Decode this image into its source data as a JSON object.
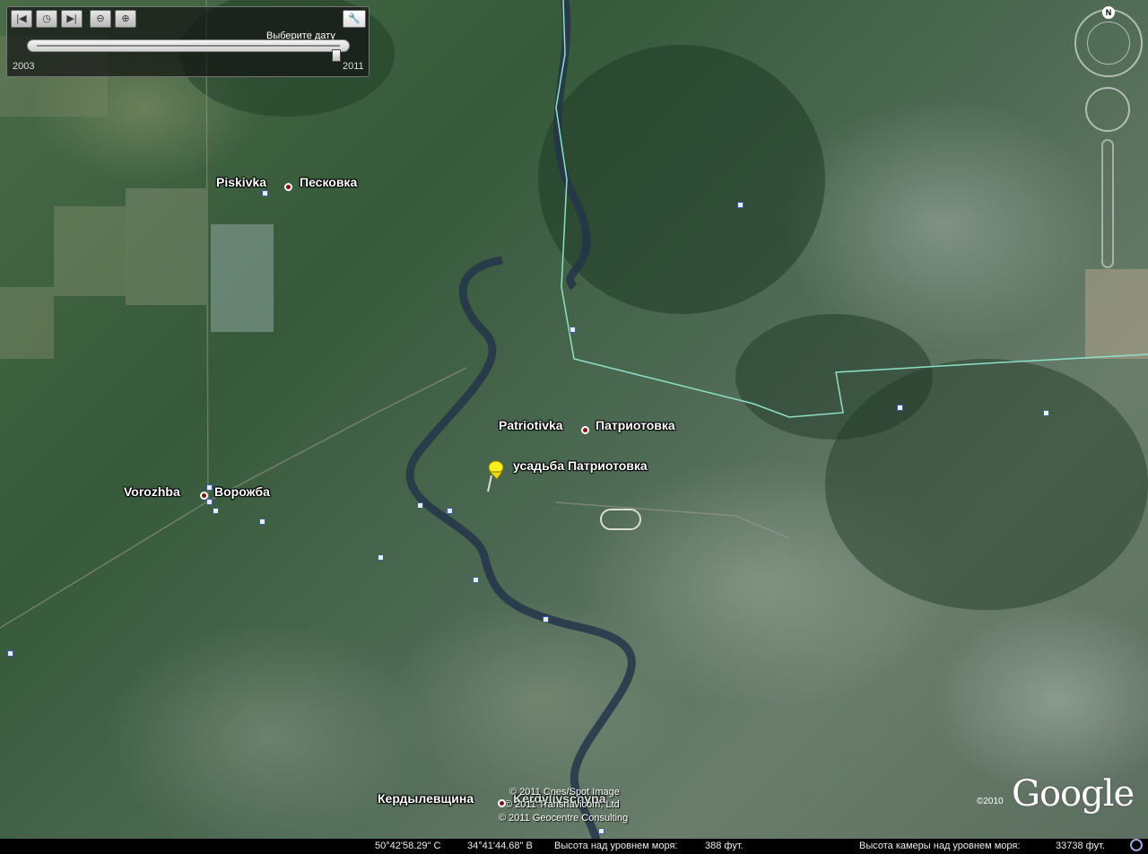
{
  "timeslider": {
    "title": "Выберите дату",
    "start_year": "2003",
    "end_year": "2011"
  },
  "places": [
    {
      "latin": "Piskivka",
      "cyrillic": "Песковка"
    },
    {
      "latin": "Patriotivka",
      "cyrillic": "Патриотовка"
    },
    {
      "latin": "Vorozhba",
      "cyrillic": "Ворожба"
    },
    {
      "latin": "Kerdylivschyna",
      "cyrillic": "Кердылевщина"
    }
  ],
  "placemark": {
    "label": "усадьба Патриотовка"
  },
  "compass": {
    "north": "N"
  },
  "credits": [
    "© 2011 Cnes/Spot Image",
    "© 2011 Transnavicom, Ltd",
    "© 2011 Geocentre Consulting"
  ],
  "logo": {
    "copyright": "©2010",
    "text": "Google"
  },
  "status": {
    "lat": "50°42'58.29\" С",
    "lon": "34°41'44.68\" В",
    "elevation_label": "Высота над уровнем моря:",
    "elevation_value": "388 фут.",
    "eye_label": "Высота камеры над уровнем моря:",
    "eye_value": "33738 фут."
  }
}
